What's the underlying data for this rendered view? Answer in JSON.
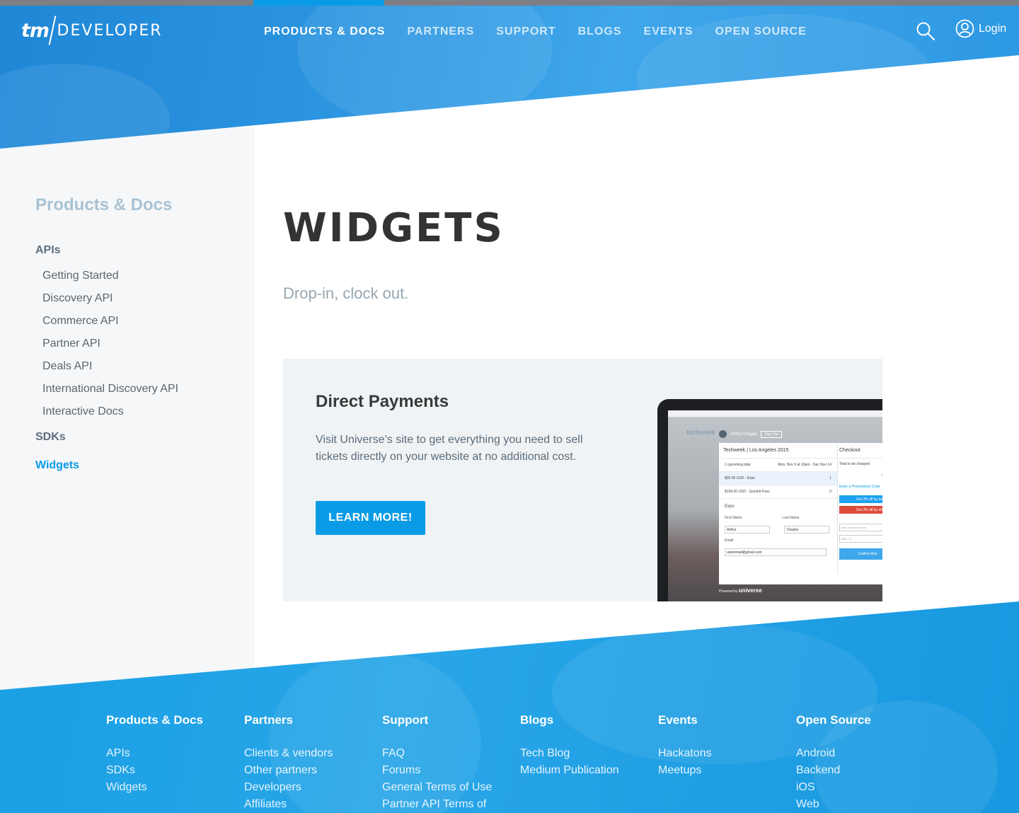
{
  "header": {
    "logo_tm": "tm",
    "logo_dev": "DEVELOPER",
    "nav": [
      {
        "label": "PRODUCTS & DOCS",
        "active": true
      },
      {
        "label": "PARTNERS"
      },
      {
        "label": "SUPPORT"
      },
      {
        "label": "BLOGS"
      },
      {
        "label": "EVENTS"
      },
      {
        "label": "OPEN SOURCE"
      }
    ],
    "login_label": "Login",
    "search_icon": "search-icon",
    "user_icon": "user-icon"
  },
  "sidebar": {
    "title": "Products & Docs",
    "apis_label": "APIs",
    "api_items": [
      "Getting Started",
      "Discovery API",
      "Commerce API",
      "Partner API",
      "Deals API",
      "International Discovery API",
      "Interactive Docs"
    ],
    "sdks_label": "SDKs",
    "widgets_label": "Widgets"
  },
  "main": {
    "title": "WIDGETS",
    "subtitle": "Drop-in, clock out.",
    "card": {
      "title": "Direct Payments",
      "description": "Visit Universe’s site to get everything you need to sell tickets directly on your website at no additional cost.",
      "button_label": "LEARN MORE!"
    },
    "mockup": {
      "user": "Arthur Chayke",
      "sign_out": "Sign Out",
      "event_title": "Techweek | Los Angeles 2015",
      "upcoming": "1 upcoming date",
      "date_range": "Mon, Nov 9 at 10am - Sat, Nov 14",
      "ticket1": "$30.00 USD - Expo",
      "ticket1_qty": "1",
      "ticket2": "$199.00 USD - Summit Pass",
      "ticket2_qty": "0",
      "expo_label": "Expo",
      "first_name_label": "First Name",
      "first_name": "Arthur",
      "last_name_label": "Last Name",
      "last_name": "Chayke",
      "email_label": "Email",
      "email": "useremail@gmail.com",
      "checkout": "Checkout",
      "total_label": "Total to be charged:",
      "includes": "Includes $2.4",
      "promo": "Enter a Promotional Code",
      "twitter_btn": "Get 3% off by tw",
      "google_btn": "Get 3% off by sh",
      "card_placeholder": "xxxx xxxx xxxx xxxx",
      "expiry_placeholder": "MM / YY",
      "confirm": "Confirm Boo",
      "powered_by": "Powered by",
      "brand": "universe",
      "site_bg": "techweek"
    }
  },
  "footer": {
    "columns": [
      {
        "heading": "Products & Docs",
        "links": [
          "APIs",
          "SDKs",
          "Widgets"
        ]
      },
      {
        "heading": "Partners",
        "links": [
          "Clients & vendors",
          "Other partners",
          "Developers",
          "Affiliates"
        ]
      },
      {
        "heading": "Support",
        "links": [
          "FAQ",
          "Forums",
          "General Terms of Use",
          "Partner API Terms of"
        ]
      },
      {
        "heading": "Blogs",
        "links": [
          "Tech Blog",
          "Medium Publication"
        ]
      },
      {
        "heading": "Events",
        "links": [
          "Hackatons",
          "Meetups"
        ]
      },
      {
        "heading": "Open Source",
        "links": [
          "Android",
          "Backend",
          "iOS",
          "Web"
        ]
      }
    ]
  },
  "colors": {
    "accent": "#0a9be6",
    "hero": "#2a93df",
    "footer": "#1a9fe4",
    "sidebar_bg": "#f6f7f9",
    "card_bg": "#eff3f6"
  }
}
